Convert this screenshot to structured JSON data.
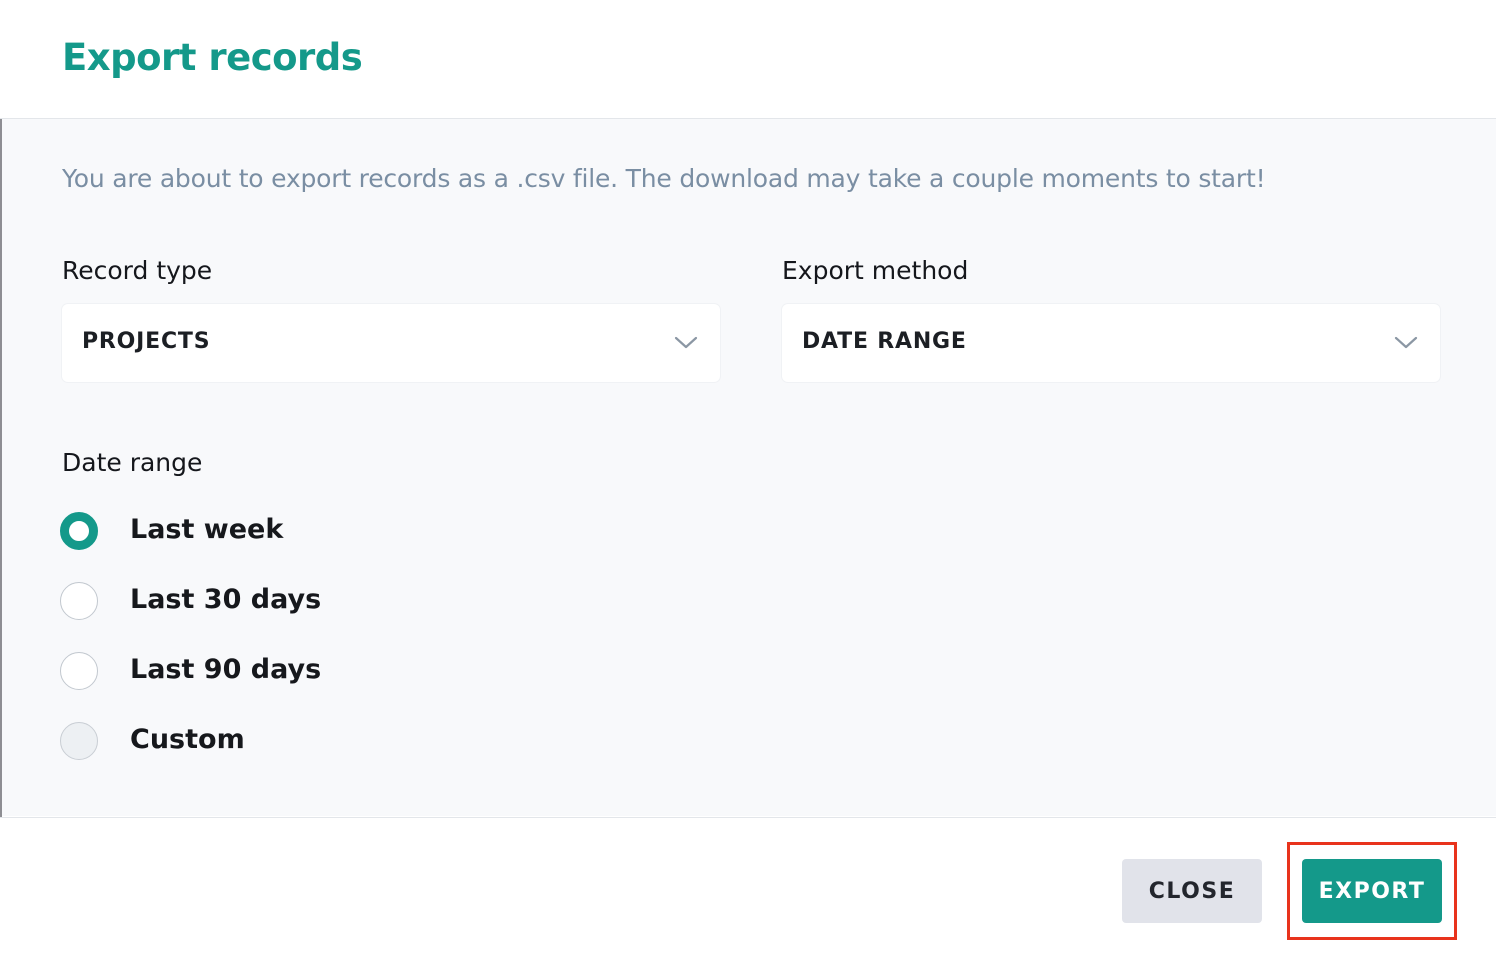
{
  "dialog": {
    "title": "Export records",
    "intro": "You are about to export records as a .csv file. The download may take a couple moments to start!"
  },
  "record_type": {
    "label": "Record type",
    "value": "PROJECTS",
    "icon": "chevron-down-icon"
  },
  "export_method": {
    "label": "Export method",
    "value": "DATE RANGE",
    "icon": "chevron-down-icon"
  },
  "date_range": {
    "label": "Date range",
    "options": [
      {
        "label": "Last week",
        "checked": true
      },
      {
        "label": "Last 30 days",
        "checked": false
      },
      {
        "label": "Last 90 days",
        "checked": false
      },
      {
        "label": "Custom",
        "checked": false,
        "disabled": true
      }
    ]
  },
  "footer": {
    "close_label": "CLOSE",
    "export_label": "EXPORT"
  },
  "colors": {
    "accent": "#14998a",
    "intro_text": "#7a8ea3",
    "highlight": "#e8331c",
    "close_bg": "#e1e3ea"
  }
}
